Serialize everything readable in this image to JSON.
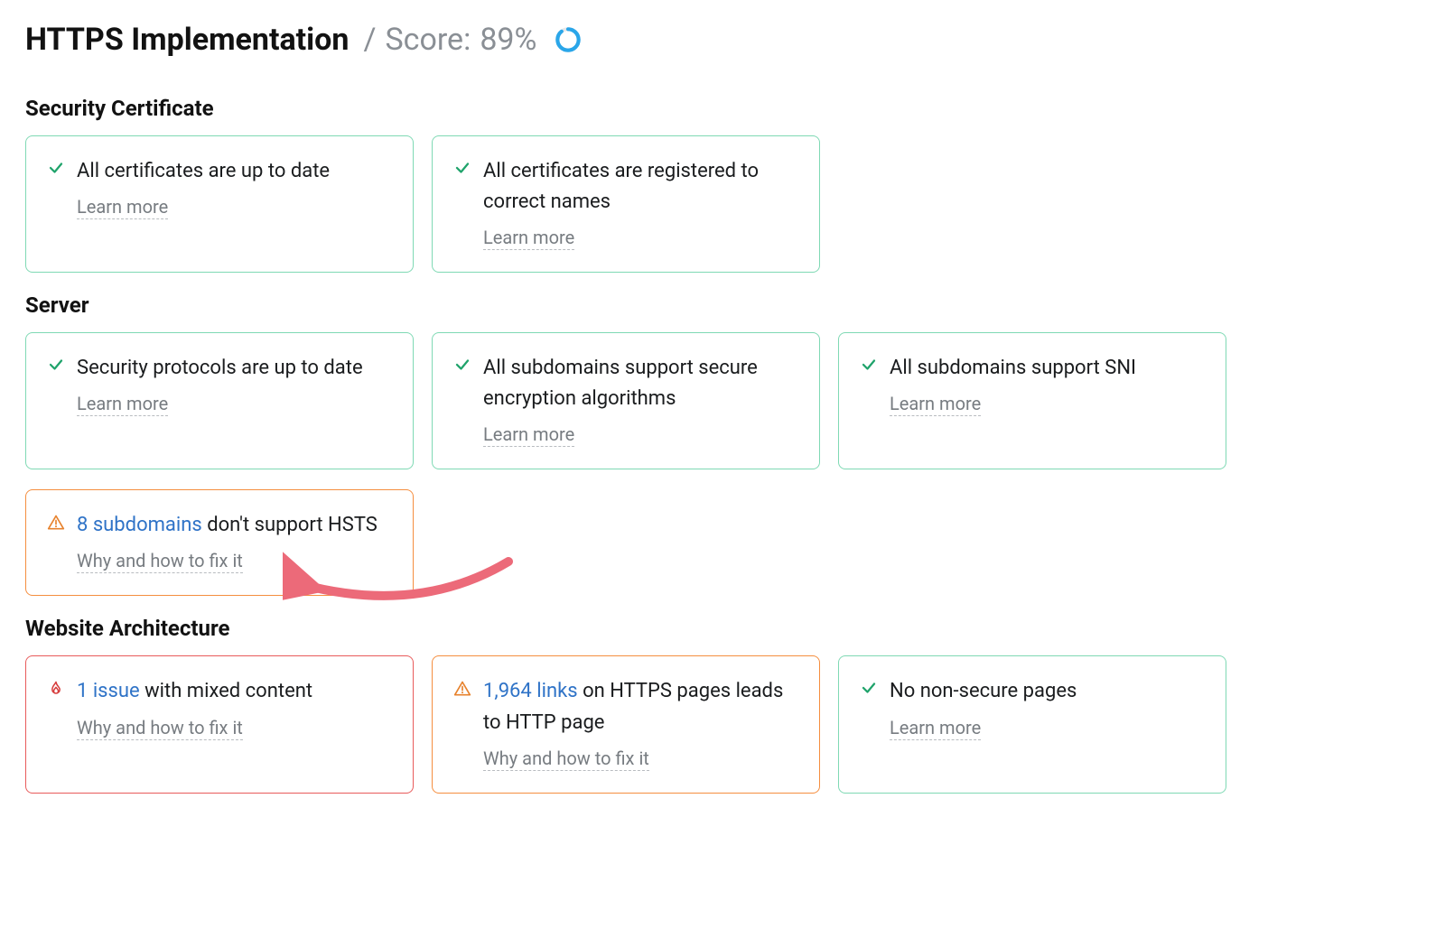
{
  "header": {
    "title": "HTTPS Implementation",
    "score_label": "Score:",
    "score_value": "89%",
    "score_percent": 89
  },
  "sections": {
    "security_certificate": {
      "title": "Security Certificate",
      "cards": [
        {
          "status": "ok",
          "text_prefix": "",
          "text": "All certificates are up to date",
          "help": "Learn more"
        },
        {
          "status": "ok",
          "text_prefix": "",
          "text": "All certificates are registered to correct names",
          "help": "Learn more"
        }
      ]
    },
    "server": {
      "title": "Server",
      "cards_row1": [
        {
          "status": "ok",
          "text_prefix": "",
          "text": "Security protocols are up to date",
          "help": "Learn more"
        },
        {
          "status": "ok",
          "text_prefix": "",
          "text": "All subdomains support secure encryption algorithms",
          "help": "Learn more"
        },
        {
          "status": "ok",
          "text_prefix": "",
          "text": "All subdomains support SNI",
          "help": "Learn more"
        }
      ],
      "cards_row2": [
        {
          "status": "warn",
          "link_text": "8 subdomains",
          "text_rest": " don't support HSTS",
          "help": "Why and how to fix it"
        }
      ]
    },
    "website_architecture": {
      "title": "Website Architecture",
      "cards": [
        {
          "status": "err",
          "link_text": "1 issue",
          "text_rest": " with mixed content",
          "help": "Why and how to fix it"
        },
        {
          "status": "warn",
          "link_text": "1,964 links",
          "text_rest": " on HTTPS pages leads to HTTP page",
          "help": "Why and how to fix it"
        },
        {
          "status": "ok",
          "text_prefix": "",
          "text": "No non-secure pages",
          "help": "Learn more"
        }
      ]
    }
  }
}
